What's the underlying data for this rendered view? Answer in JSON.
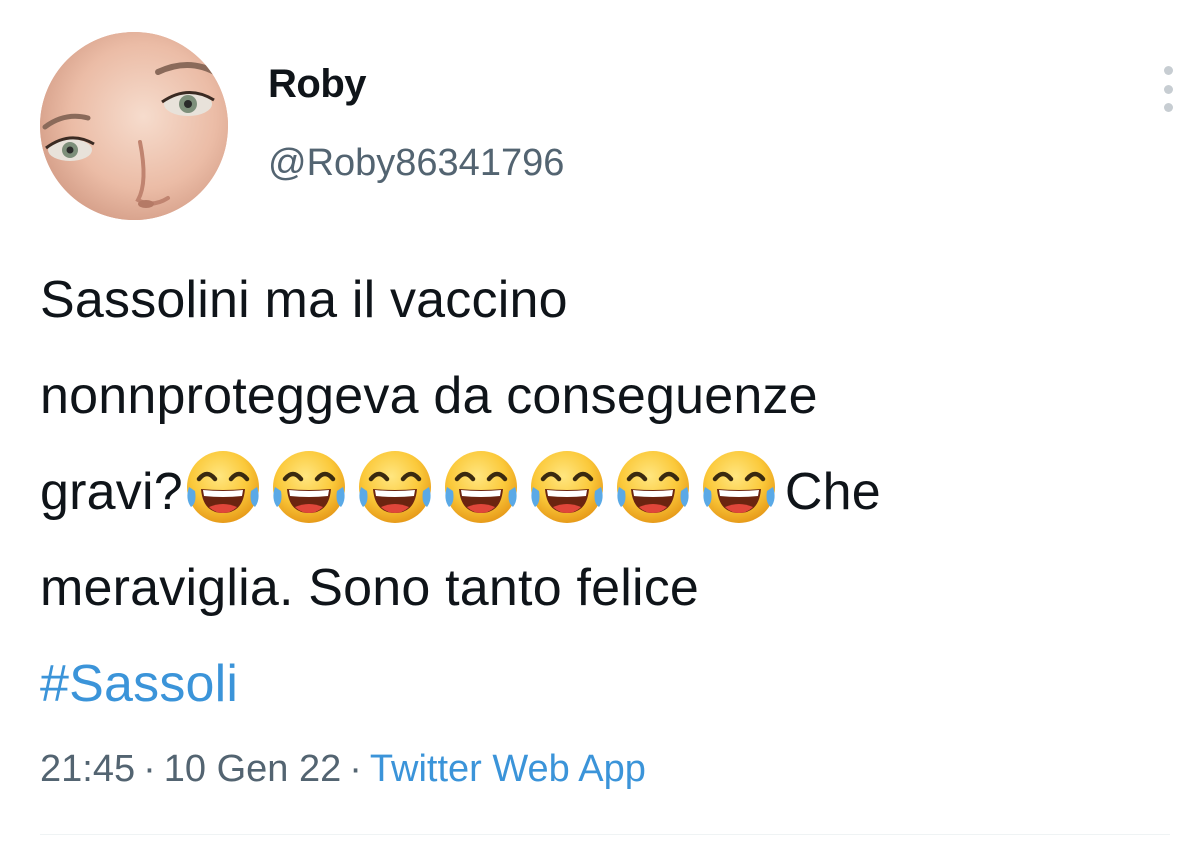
{
  "user": {
    "name": "Roby",
    "handle": "@Roby86341796"
  },
  "tweet": {
    "line1": "Sassolini ma il vaccino",
    "line2": "nonnproteggeva da conseguenze",
    "line3_before": "gravi?",
    "line3_after": "Che",
    "line4": "meraviglia.  Sono tanto felice",
    "hashtag": "#Sassoli",
    "emoji_name": "face-with-tears-of-joy-icon",
    "emoji_count": 7
  },
  "meta": {
    "time": "21:45",
    "separator": "·",
    "date": "10 Gen 22",
    "source": "Twitter Web App"
  },
  "colors": {
    "text": "#0f1419",
    "secondary": "#536471",
    "link": "#3b94d9"
  }
}
